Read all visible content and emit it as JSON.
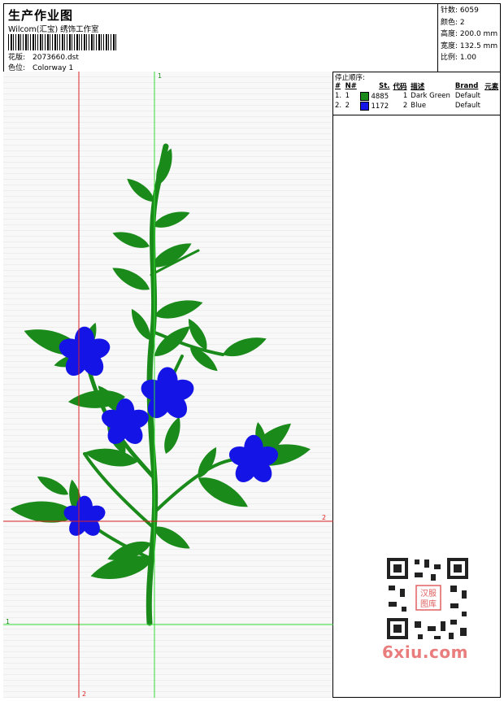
{
  "header": {
    "title": "生产作业图",
    "studio": "Wilcom(汇宝) 绣饰工作室",
    "pattern_label": "花版:",
    "pattern_value": "2073660.dst",
    "colorway_label": "色位:",
    "colorway_value": "Colorway 1"
  },
  "stats": [
    {
      "label": "针数:",
      "value": "6059"
    },
    {
      "label": "颜色:",
      "value": "2"
    },
    {
      "label": "高度:",
      "value": "200.0 mm"
    },
    {
      "label": "宽度:",
      "value": "132.5 mm"
    },
    {
      "label": "比例:",
      "value": "1.00"
    }
  ],
  "stop_sequence": {
    "caption": "停止顺序:",
    "columns": [
      "#",
      "N#",
      "St.",
      "代码",
      "描述",
      "Brand",
      "元素"
    ],
    "rows": [
      {
        "num": "1.",
        "n": "1",
        "color": "#1a8a1a",
        "stitches": "4885",
        "code": "1",
        "desc": "Dark Green",
        "brand": "Default",
        "elem": ""
      },
      {
        "num": "2.",
        "n": "2",
        "color": "#1414e6",
        "stitches": "1172",
        "code": "2",
        "desc": "Blue",
        "brand": "Default",
        "elem": ""
      }
    ]
  },
  "guides": {
    "green_v": "1",
    "green_h": "1",
    "red_v": "2",
    "red_h": "2"
  },
  "colors": {
    "leaf": "#1a8a1a",
    "flower": "#1414e6",
    "guide_green": "#33dd33",
    "guide_red": "#dd2222"
  },
  "watermark": {
    "text": "6xiu.com",
    "qr_text": "汉服图库"
  }
}
